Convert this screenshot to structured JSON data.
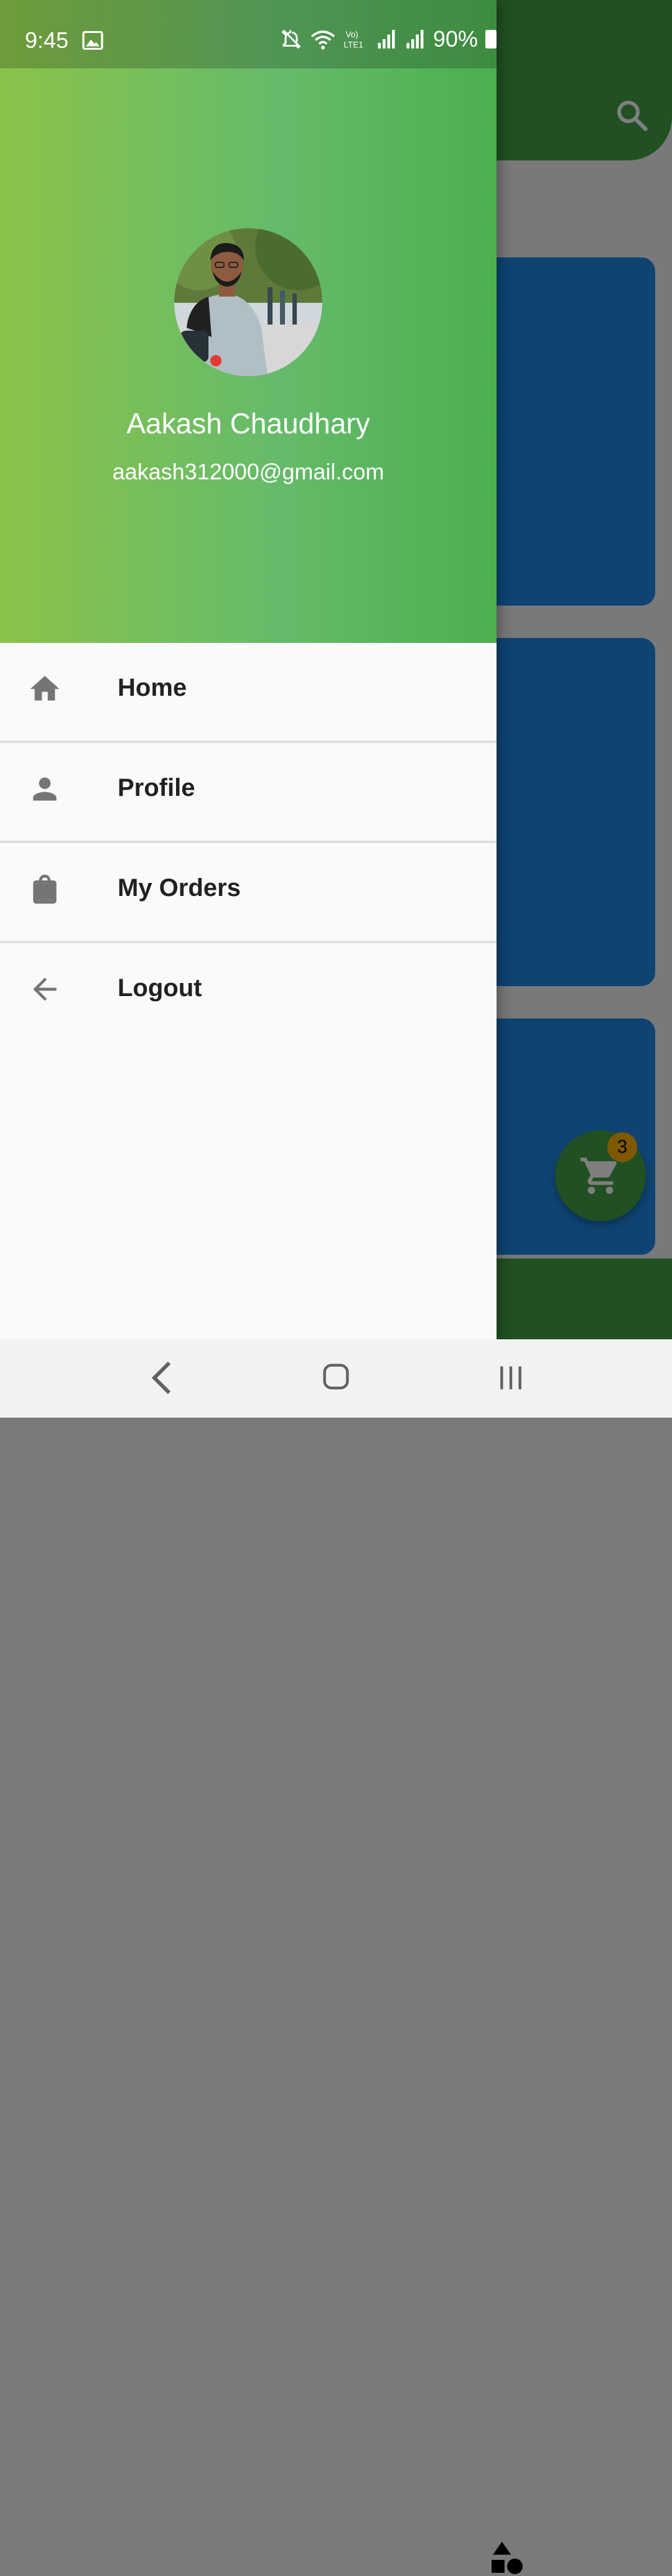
{
  "status_bar": {
    "time": "9:45",
    "battery": "90%",
    "icons": [
      "gallery-icon",
      "mute-icon",
      "wifi-icon",
      "volte-icon",
      "signal-icon",
      "signal-icon",
      "battery-icon"
    ]
  },
  "drawer": {
    "user": {
      "name": "Aakash Chaudhary",
      "email": "aakash312000@gmail.com"
    },
    "items": [
      {
        "label": "Home",
        "icon": "home-icon"
      },
      {
        "label": "Profile",
        "icon": "person-icon"
      },
      {
        "label": "My Orders",
        "icon": "shopping-bag-icon"
      },
      {
        "label": "Logout",
        "icon": "arrow-back-icon"
      }
    ]
  },
  "background_app": {
    "cart_badge": "3",
    "icons": [
      "search-icon",
      "cart-icon",
      "shapes-icon"
    ]
  },
  "colors": {
    "header_gradient_start": "#8bc34a",
    "header_gradient_end": "#4caf50",
    "appbar": "#43a047",
    "card": "#1e88e5",
    "badge": "#ffb300"
  },
  "nav_bar": {
    "buttons": [
      "back-nav-icon",
      "home-nav-icon",
      "recents-nav-icon"
    ]
  }
}
